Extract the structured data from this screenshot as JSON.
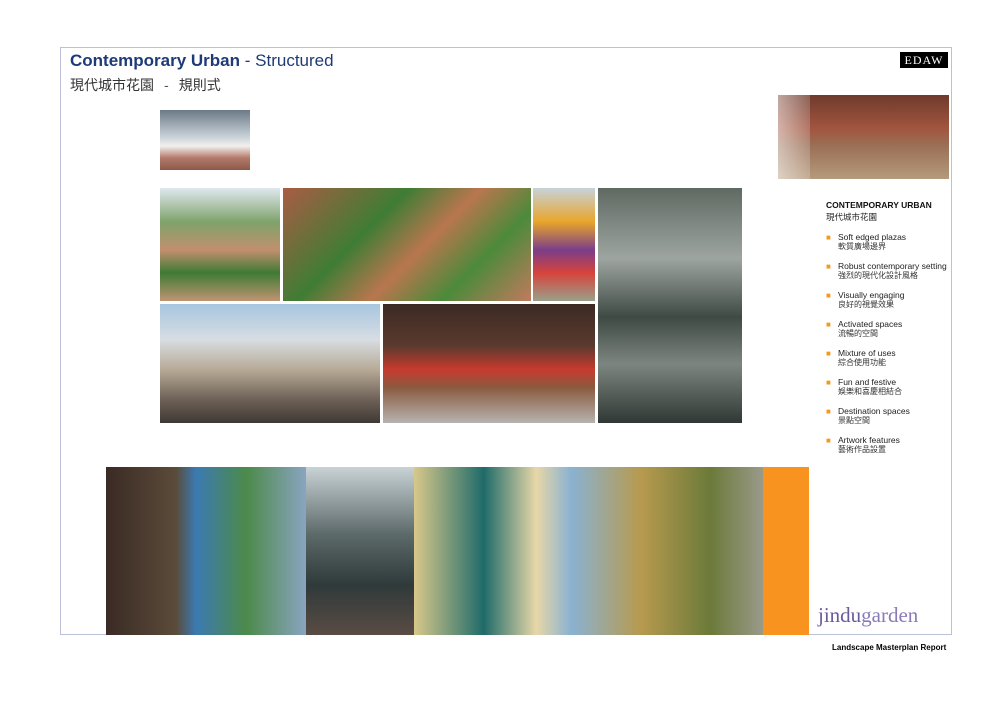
{
  "header": {
    "title_bold": "Contemporary Urban",
    "title_rest": " - Structured",
    "subtitle_cn": "現代城市花園",
    "subtitle_dash": "-",
    "subtitle_cn_2": "規則式",
    "firm_logo": "EDAW"
  },
  "sidebar": {
    "heading": "CONTEMPORARY URBAN",
    "heading_cn": "現代城市花園",
    "items": [
      {
        "en": "Soft edged plazas",
        "cn": "軟質廣場邊界"
      },
      {
        "en": "Robust contemporary setting",
        "cn": "強烈的現代化設計風格"
      },
      {
        "en": "Visually engaging",
        "cn": "良好的視覺效果"
      },
      {
        "en": "Activated spaces",
        "cn": "流暢的空間"
      },
      {
        "en": "Mixture of uses",
        "cn": "綜合使用功能"
      },
      {
        "en": "Fun and festive",
        "cn": "娛樂和喜慶相結合"
      },
      {
        "en": "Destination spaces",
        "cn": "景點空間"
      },
      {
        "en": "Artwork features",
        "cn": "藝術作品設置"
      }
    ]
  },
  "footer": {
    "brand_a": "jindu",
    "brand_b": "garden",
    "report": "Landscape Masterplan Report"
  },
  "colors": {
    "title_blue": "#1e3a78",
    "accent_orange": "#f7931e",
    "brand_purple": "#6a5a9c"
  }
}
